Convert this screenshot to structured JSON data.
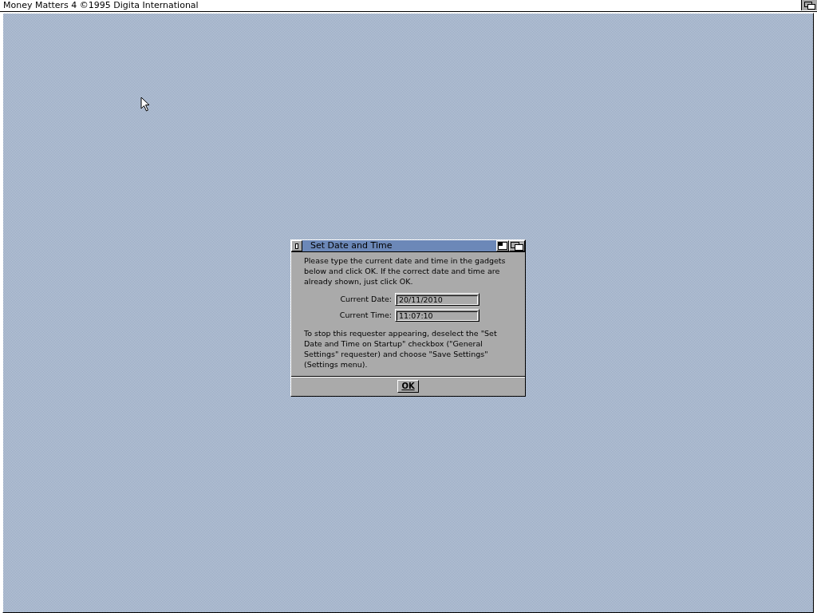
{
  "screen": {
    "title": "Money Matters 4 ©1995 Digita International"
  },
  "dialog": {
    "title": "Set Date and Time",
    "intro": "Please type the current date and time in the gadgets below and click OK. If the correct date and time are already shown, just click OK.",
    "fields": [
      {
        "label": "Current Date:",
        "value": "20/11/2010"
      },
      {
        "label": "Current Time:",
        "value": "11:07:10"
      }
    ],
    "note": "To stop this requester appearing, deselect the \"Set Date and Time on Startup\" checkbox (\"General Settings\" requester) and choose \"Save Settings\" (Settings menu).",
    "buttons": [
      "OK"
    ]
  }
}
